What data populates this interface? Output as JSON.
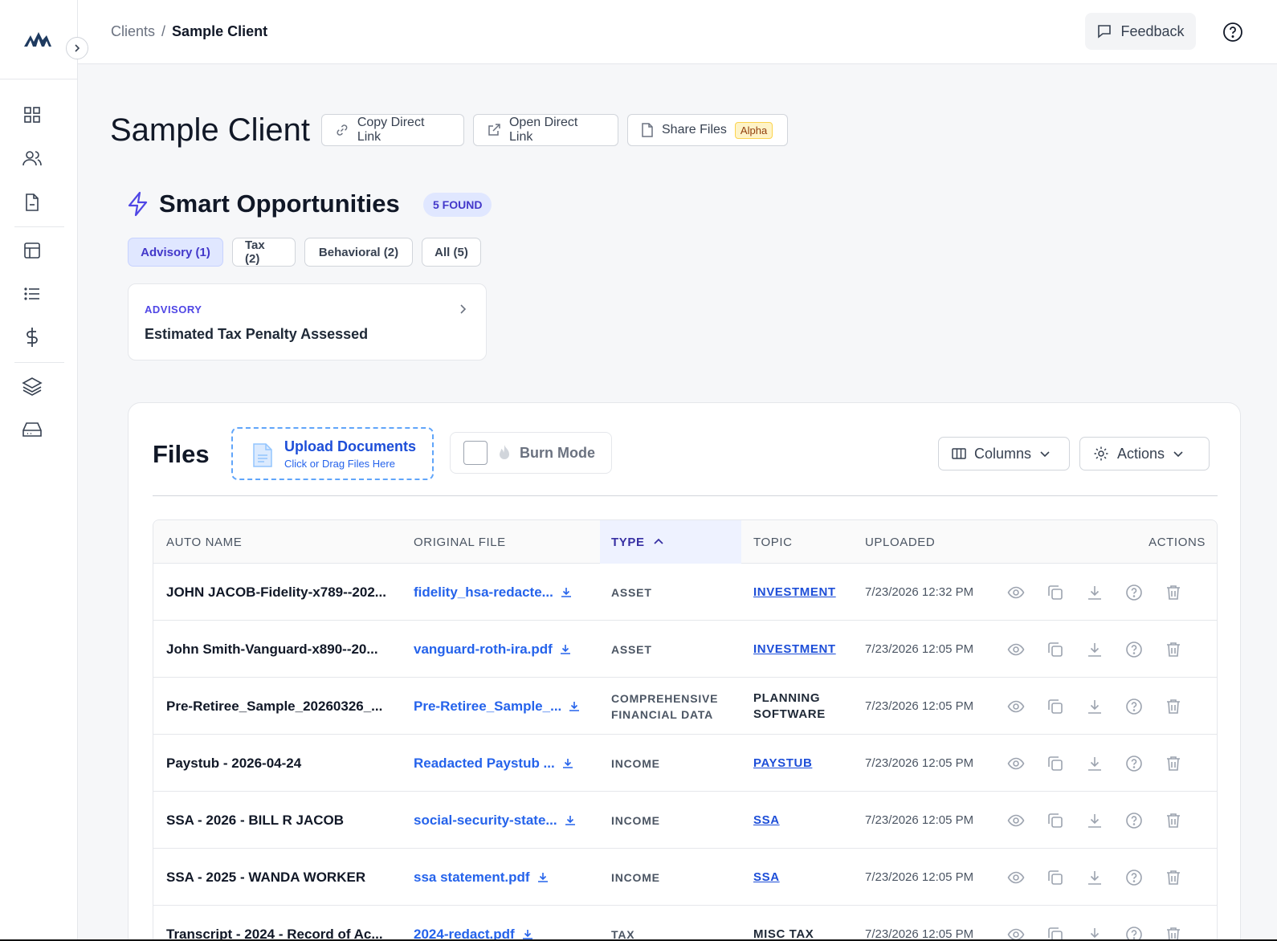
{
  "breadcrumb": {
    "root": "Clients",
    "separator": "/",
    "current": "Sample Client"
  },
  "topbar": {
    "feedback_label": "Feedback"
  },
  "page": {
    "title": "Sample Client",
    "copy_link_label": "Copy Direct Link",
    "open_link_label": "Open Direct Link",
    "share_files_label": "Share Files",
    "share_badge": "Alpha"
  },
  "opportunities": {
    "title": "Smart Opportunities",
    "found_badge": "5 FOUND",
    "tabs": [
      {
        "label": "Advisory (1)",
        "active": true
      },
      {
        "label": "Tax (2)",
        "active": false
      },
      {
        "label": "Behavioral (2)",
        "active": false
      },
      {
        "label": "All (5)",
        "active": false
      }
    ],
    "card": {
      "category": "ADVISORY",
      "title": "Estimated Tax Penalty Assessed"
    }
  },
  "files": {
    "title": "Files",
    "upload_title": "Upload Documents",
    "upload_subtitle": "Click or Drag Files Here",
    "burn_mode_label": "Burn Mode",
    "columns_label": "Columns",
    "actions_label": "Actions",
    "headers": {
      "auto_name": "AUTO NAME",
      "original_file": "ORIGINAL FILE",
      "type": "TYPE",
      "topic": "TOPIC",
      "uploaded": "UPLOADED",
      "actions": "ACTIONS"
    },
    "rows": [
      {
        "auto_name": "JOHN JACOB-Fidelity-x789--202...",
        "original_file": "fidelity_hsa-redacte...",
        "type": "ASSET",
        "topic": "INVESTMENT",
        "uploaded": "7/23/2026 12:32 PM"
      },
      {
        "auto_name": "John Smith-Vanguard-x890--20...",
        "original_file": "vanguard-roth-ira.pdf",
        "type": "ASSET",
        "topic": "INVESTMENT",
        "uploaded": "7/23/2026 12:05 PM"
      },
      {
        "auto_name": "Pre-Retiree_Sample_20260326_...",
        "original_file": "Pre-Retiree_Sample_...",
        "type": "COMPREHENSIVE FINANCIAL DATA",
        "topic": "PLANNING SOFTWARE",
        "uploaded": "7/23/2026 12:05 PM"
      },
      {
        "auto_name": "Paystub - 2026-04-24",
        "original_file": "Readacted Paystub ...",
        "type": "INCOME",
        "topic": "PAYSTUB",
        "uploaded": "7/23/2026 12:05 PM"
      },
      {
        "auto_name": "SSA - 2026 - BILL R JACOB",
        "original_file": "social-security-state...",
        "type": "INCOME",
        "topic": "SSA",
        "uploaded": "7/23/2026 12:05 PM"
      },
      {
        "auto_name": "SSA - 2025 - WANDA WORKER",
        "original_file": "ssa statement.pdf",
        "type": "INCOME",
        "topic": "SSA",
        "uploaded": "7/23/2026 12:05 PM"
      },
      {
        "auto_name": "Transcript - 2024 - Record of Ac...",
        "original_file": "2024-redact.pdf",
        "type": "TAX",
        "topic": "MISC TAX",
        "uploaded": "7/23/2026 12:05 PM"
      }
    ]
  },
  "colors": {
    "accent": "#4338ca",
    "link": "#2563eb",
    "brand_logo": "#1e3a5f"
  },
  "icons": [
    "logo-icon",
    "chevron-right-icon",
    "grid-icon",
    "users-icon",
    "document-icon",
    "layout-icon",
    "list-icon",
    "dollar-icon",
    "layers-icon",
    "inbox-icon",
    "message-icon",
    "help-icon",
    "link-icon",
    "external-link-icon",
    "file-icon",
    "lightning-icon",
    "flame-icon",
    "columns-icon",
    "gear-icon",
    "chevron-down-icon",
    "chevron-up-icon",
    "eye-icon",
    "copy-icon",
    "download-icon",
    "question-icon",
    "trash-icon"
  ]
}
